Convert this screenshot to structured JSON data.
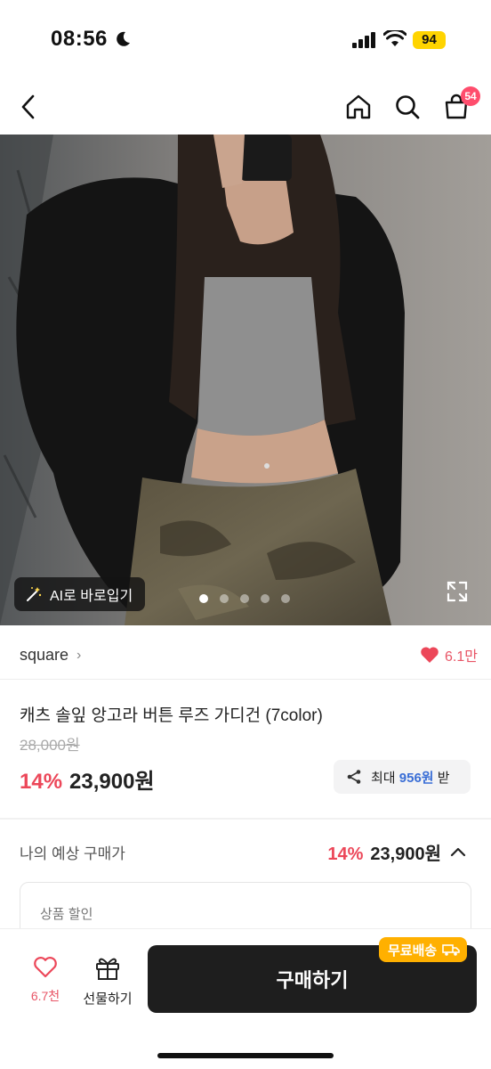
{
  "status_bar": {
    "time": "08:56",
    "battery": "94"
  },
  "header": {
    "cart_count": "54"
  },
  "hero": {
    "ai_button_label": "AI로 바로입기",
    "dot_count": 5,
    "active_dot": 0
  },
  "shop": {
    "name": "square",
    "like_count": "6.1만"
  },
  "product": {
    "title": "캐츠 솔잎 앙고라 버튼 루즈 가디건 (7color)",
    "original_price": "28,000원",
    "discount": "14%",
    "price": "23,900원",
    "share_prefix": "최대",
    "share_amount": "956원",
    "share_suffix": "받"
  },
  "estimate": {
    "label": "나의 예상 구매가",
    "discount": "14%",
    "price": "23,900원"
  },
  "discount_box": {
    "label": "상품 할인"
  },
  "bottom_bar": {
    "wish_count": "6.7천",
    "gift_label": "선물하기",
    "buy_label": "구매하기",
    "free_shipping_label": "무료배송"
  },
  "colors": {
    "accent_red": "#ec4759",
    "buy_button": "#1e1e1e",
    "free_shipping": "#ffb000",
    "share_highlight": "#3b6fd6"
  }
}
